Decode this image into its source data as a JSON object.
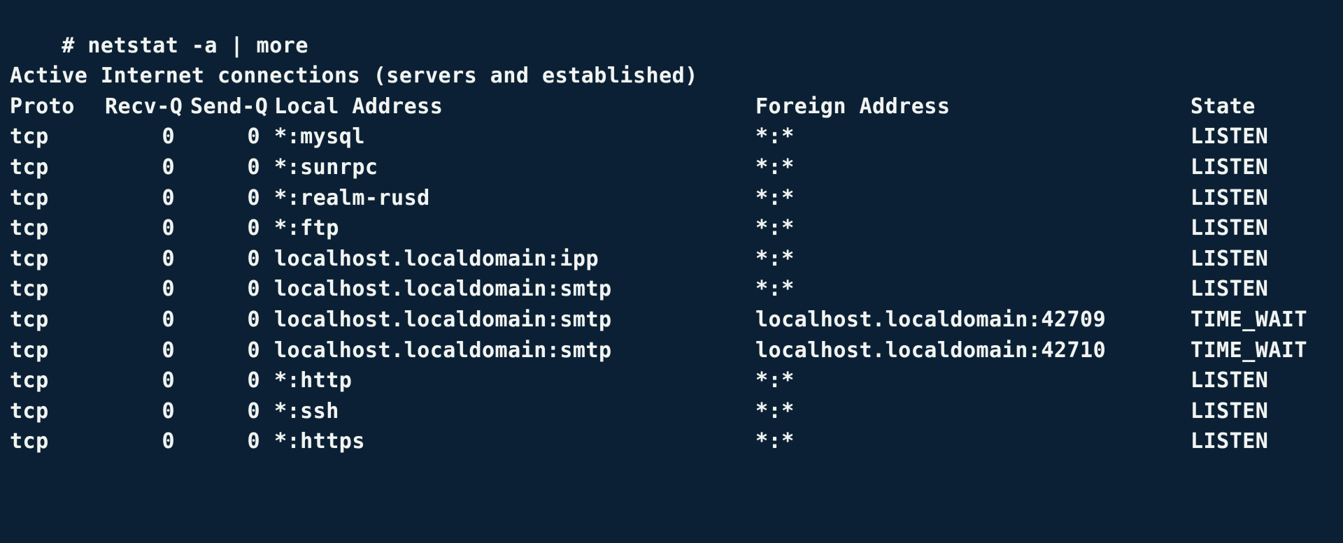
{
  "terminal": {
    "background_color": "#0b2034",
    "foreground_color": "#f2f4f2",
    "prompt_symbol": "#",
    "command": "netstat -a | more",
    "command_line": "# netstat -a | more",
    "banner": "Active Internet connections (servers and established)",
    "headers": {
      "proto": "Proto",
      "recv_q": "Recv-Q",
      "send_q": "Send-Q",
      "local_address": "Local Address",
      "foreign_address": "Foreign Address",
      "state": "State"
    },
    "rows": [
      {
        "proto": "tcp",
        "recv_q": "0",
        "send_q": "0",
        "local_address": "*:mysql",
        "foreign_address": "*:*",
        "state": "LISTEN"
      },
      {
        "proto": "tcp",
        "recv_q": "0",
        "send_q": "0",
        "local_address": "*:sunrpc",
        "foreign_address": "*:*",
        "state": "LISTEN"
      },
      {
        "proto": "tcp",
        "recv_q": "0",
        "send_q": "0",
        "local_address": "*:realm-rusd",
        "foreign_address": "*:*",
        "state": "LISTEN"
      },
      {
        "proto": "tcp",
        "recv_q": "0",
        "send_q": "0",
        "local_address": "*:ftp",
        "foreign_address": "*:*",
        "state": "LISTEN"
      },
      {
        "proto": "tcp",
        "recv_q": "0",
        "send_q": "0",
        "local_address": "localhost.localdomain:ipp",
        "foreign_address": "*:*",
        "state": "LISTEN"
      },
      {
        "proto": "tcp",
        "recv_q": "0",
        "send_q": "0",
        "local_address": "localhost.localdomain:smtp",
        "foreign_address": "*:*",
        "state": "LISTEN"
      },
      {
        "proto": "tcp",
        "recv_q": "0",
        "send_q": "0",
        "local_address": "localhost.localdomain:smtp",
        "foreign_address": "localhost.localdomain:42709",
        "state": "TIME_WAIT"
      },
      {
        "proto": "tcp",
        "recv_q": "0",
        "send_q": "0",
        "local_address": "localhost.localdomain:smtp",
        "foreign_address": "localhost.localdomain:42710",
        "state": "TIME_WAIT"
      },
      {
        "proto": "tcp",
        "recv_q": "0",
        "send_q": "0",
        "local_address": "*:http",
        "foreign_address": "*:*",
        "state": "LISTEN"
      },
      {
        "proto": "tcp",
        "recv_q": "0",
        "send_q": "0",
        "local_address": "*:ssh",
        "foreign_address": "*:*",
        "state": "LISTEN"
      },
      {
        "proto": "tcp",
        "recv_q": "0",
        "send_q": "0",
        "local_address": "*:https",
        "foreign_address": "*:*",
        "state": "LISTEN"
      }
    ]
  }
}
